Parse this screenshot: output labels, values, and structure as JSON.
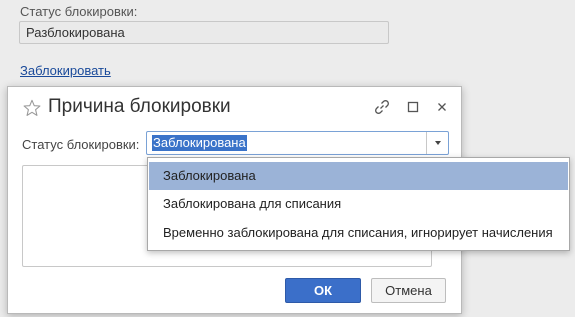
{
  "form": {
    "status_label": "Статус блокировки:",
    "status_value": "Разблокирована",
    "block_link": "Заблокировать"
  },
  "dialog": {
    "title": "Причина блокировки",
    "status_label": "Статус блокировки:",
    "status_value": "Заблокирована",
    "ok_label": "ОК",
    "cancel_label": "Отмена"
  },
  "dropdown": {
    "items": [
      "Заблокирована",
      "Заблокирована для списания",
      "Временно заблокирована для списания, игнорирует начисления"
    ],
    "selected": "Заблокирована"
  },
  "icons": {
    "favorite": "star-icon",
    "link": "link-icon",
    "maximize": "maximize-icon",
    "close": "close-icon",
    "dropdown": "chevron-down-icon"
  },
  "colors": {
    "accent": "#3b6fc9",
    "link": "#1a4a9a",
    "selected_item": "#9bb3d7",
    "text_highlight": "#3a73c9"
  }
}
